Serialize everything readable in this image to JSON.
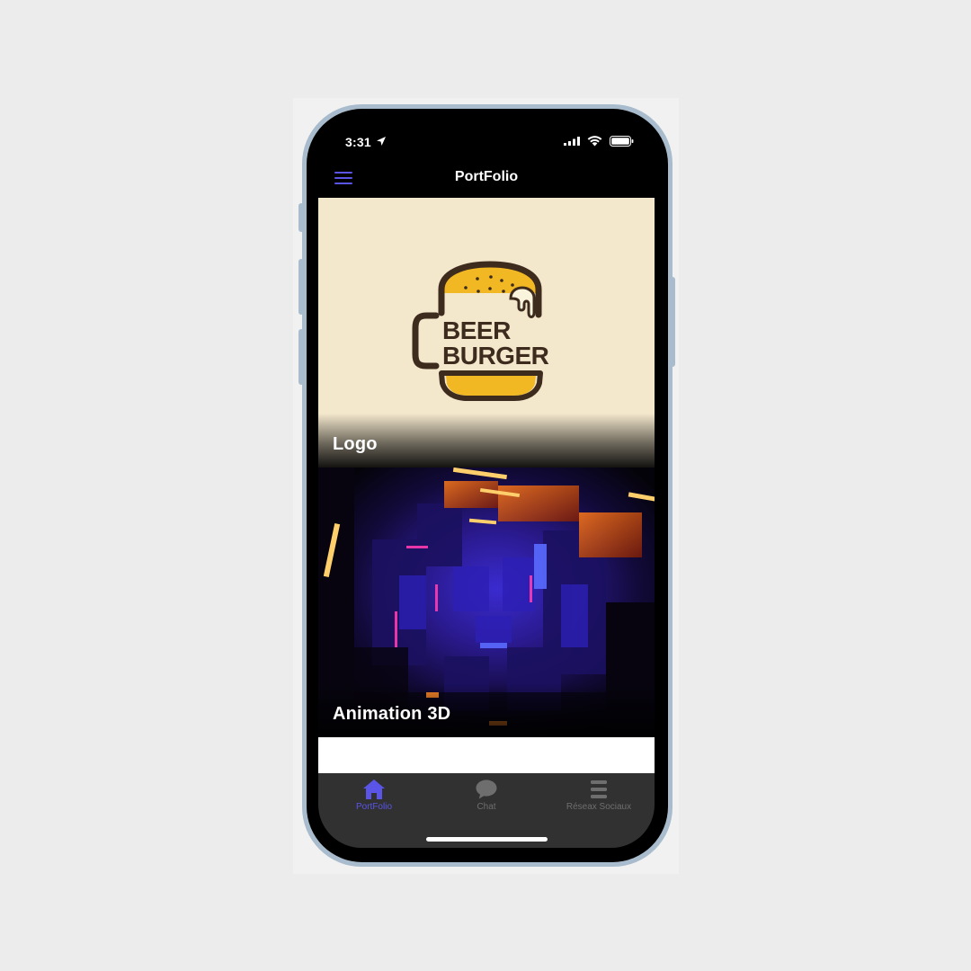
{
  "status_bar": {
    "time": "3:31"
  },
  "header": {
    "title": "PortFolio"
  },
  "cards": [
    {
      "title": "Logo",
      "image": {
        "brand_line1": "BEER",
        "brand_line2": "BURGER"
      }
    },
    {
      "title": "Animation 3D"
    }
  ],
  "tab_bar": {
    "tabs": [
      {
        "label": "PortFolio",
        "icon": "home-icon",
        "active": true
      },
      {
        "label": "Chat",
        "icon": "chat-bubble-icon",
        "active": false
      },
      {
        "label": "Réseax Sociaux",
        "icon": "list-icon",
        "active": false
      }
    ]
  },
  "colors": {
    "accent": "#5a55e6",
    "tab_bar_bg": "#313131",
    "logo_bg": "#f3e7cc",
    "burger_yellow": "#f2b824",
    "burger_brown": "#3d2b1e"
  }
}
